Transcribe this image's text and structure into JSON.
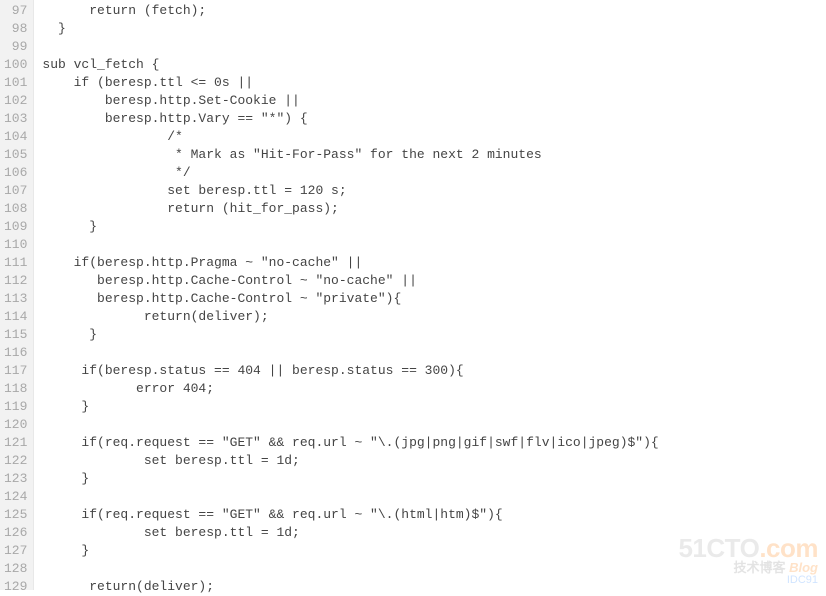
{
  "gutter_start": 97,
  "code_lines": [
    "      return (fetch);",
    "  }",
    "",
    "sub vcl_fetch {",
    "    if (beresp.ttl <= 0s ||",
    "        beresp.http.Set-Cookie ||",
    "        beresp.http.Vary == \"*\") {",
    "                /*",
    "                 * Mark as \"Hit-For-Pass\" for the next 2 minutes",
    "                 */",
    "                set beresp.ttl = 120 s;",
    "                return (hit_for_pass);",
    "      }",
    "",
    "    if(beresp.http.Pragma ~ \"no-cache\" ||",
    "       beresp.http.Cache-Control ~ \"no-cache\" ||",
    "       beresp.http.Cache-Control ~ \"private\"){",
    "             return(deliver);",
    "      }",
    "",
    "     if(beresp.status == 404 || beresp.status == 300){",
    "            error 404;",
    "     }",
    "",
    "     if(req.request == \"GET\" && req.url ~ \"\\.(jpg|png|gif|swf|flv|ico|jpeg)$\"){",
    "             set beresp.ttl = 1d;",
    "     }",
    "",
    "     if(req.request == \"GET\" && req.url ~ \"\\.(html|htm)$\"){",
    "             set beresp.ttl = 1d;",
    "     }",
    "",
    "      return(deliver);"
  ],
  "watermark": {
    "line1_main": "51CTO",
    "line1_suffix": ".com",
    "line2_cn": "技术博客",
    "line2_blog": "Blog",
    "line3": "IDC91"
  }
}
